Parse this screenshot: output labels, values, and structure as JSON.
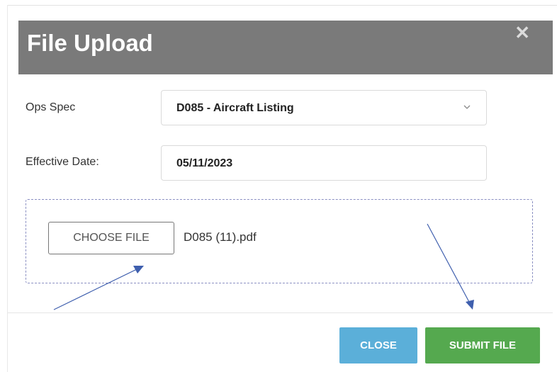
{
  "dialog": {
    "title": "File Upload",
    "close_symbol": "✕"
  },
  "fields": {
    "ops_spec": {
      "label": "Ops Spec",
      "value": "D085 - Aircraft Listing",
      "icon": "chevron-down-icon"
    },
    "effective_date": {
      "label": "Effective Date:",
      "value": "05/11/2023"
    }
  },
  "upload": {
    "choose_label": "CHOOSE FILE",
    "file_name": "D085 (11).pdf"
  },
  "footer": {
    "close_label": "CLOSE",
    "submit_label": "SUBMIT FILE"
  },
  "colors": {
    "header_bg": "#7a7a7a",
    "close_button": "#5bafd9",
    "submit_button": "#55a94f",
    "annotation_arrow": "#3f5fae",
    "dropzone_border": "#8a8fc2"
  }
}
